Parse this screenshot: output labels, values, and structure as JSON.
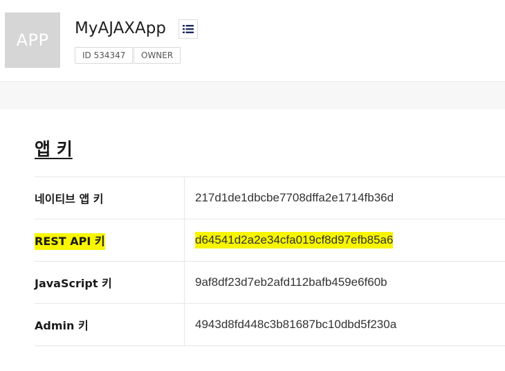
{
  "app": {
    "thumb_text": "APP",
    "name": "MyAJAXApp",
    "id_badge": "ID 534347",
    "role_badge": "OWNER",
    "menu_icon": "list-icon"
  },
  "section": {
    "title": "앱 키"
  },
  "keys": [
    {
      "label": "네이티브 앱 키",
      "value": "217d1de1dbcbe7708dffa2e1714fb36d"
    },
    {
      "label": "REST API 키",
      "value": "d64541d2a2e34cfa019cf8d97efb85a6"
    },
    {
      "label": "JavaScript 키",
      "value": "9af8df23d7eb2afd112bafb459e6f60b"
    },
    {
      "label": "Admin 키",
      "value": "4943d8fd448c3b81687bc10dbd5f230a"
    }
  ],
  "colors": {
    "highlight": "#f7f500",
    "thumb_bg": "#d6d6d6",
    "menu_icon": "#1b2a5c"
  }
}
